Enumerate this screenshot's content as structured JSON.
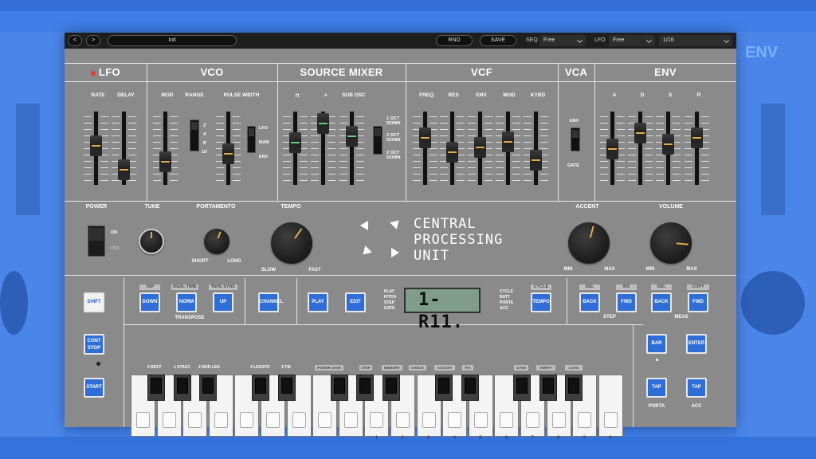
{
  "window": {
    "preset_name": "Init",
    "back_label": "<",
    "forward_label": ">",
    "rnd_label": "RND",
    "save_label": "SAVE",
    "seq_label": "SEQ",
    "seq_value": "Free",
    "lfo_label": "LFO",
    "lfo_value": "Free",
    "rate_value": "1/16"
  },
  "sections": {
    "lfo": "LFO",
    "vco": "VCO",
    "source_mixer": "SOURCE MIXER",
    "vcf": "VCF",
    "vca": "VCA",
    "env": "ENV"
  },
  "lfo": {
    "rate": "RATE",
    "delay": "DELAY"
  },
  "vco": {
    "mod": "MOD",
    "range": "RANGE",
    "pulse_width": "PULSE WIDTH",
    "range_marks": [
      "2'",
      "4'",
      "8'",
      "16'"
    ],
    "pw_modes": [
      "LFO",
      "MAN",
      "ENV"
    ]
  },
  "mixer": {
    "saw": "⩘",
    "square": "⊓",
    "sub_osc": "SUB OSC",
    "sub_modes": [
      "1 OCT DOWN",
      "2 OCT DOWN",
      "2 OCT DOWN"
    ]
  },
  "vcf": {
    "freq": "FREQ",
    "res": "RES",
    "env": "ENV",
    "mod": "MOD",
    "kybd": "KYBD"
  },
  "vca": {
    "env": "ENV",
    "gate": "GATE"
  },
  "env": {
    "a": "A",
    "d": "D",
    "s": "S",
    "r": "R"
  },
  "controls": {
    "power": "POWER",
    "on": "ON",
    "off": "OFF",
    "tune": "TUNE",
    "portamento": "PORTAMENTO",
    "short": "SHORT",
    "long": "LONG",
    "tempo": "TEMPO",
    "slow": "SLOW",
    "fast": "FAST",
    "accent": "ACCENT",
    "volume": "VOLUME",
    "min": "MIN",
    "max": "MAX"
  },
  "logo": {
    "line1": "CENTRAL",
    "line2": "PROCESSING",
    "line3": "UNIT"
  },
  "buttons": {
    "shift": "SHIFT",
    "tap": "TAP",
    "real_time": "REAL TIME",
    "tape_sync": "TAPE SYNC",
    "down": "DOWN",
    "norm": "NORM",
    "up": "UP",
    "transpose": "TRANSPOSE",
    "channel": "CHANNEL",
    "play": "PLAY",
    "edit": "EDIT",
    "cycle": "CYCLE",
    "tempo": "TEMPO",
    "del": "DEL",
    "ins": "INS",
    "del2": "DEL",
    "copy": "COPY",
    "back": "BACK",
    "fwd": "FWD",
    "step": "STEP",
    "meas": "MEAS",
    "cont_stop": "CONT STOP",
    "start": "START",
    "bar": "BAR",
    "enter": "ENTER",
    "tap_porta": "TAP",
    "tap_acc": "TAP",
    "porta": "PORTA",
    "acc": "ACC"
  },
  "lcd": {
    "text": "1-R11.",
    "left_labels": [
      "PLAY",
      "PITCH",
      "STEP",
      "GATE"
    ],
    "right_labels": [
      "CYCLE",
      "BATT",
      "PORTA",
      "ACC"
    ]
  },
  "keyboard": {
    "note_labels": [
      "0 REST",
      "1 STACC",
      "2 NON LEG",
      "3 LEGATO",
      "4 TIE"
    ],
    "tags": [
      "POWER SAVE",
      "STEP",
      "MEMORY",
      "CHECK",
      "ACCENT",
      "F/A",
      "SAVE",
      "VERIFY",
      "LOAD"
    ],
    "numbers": [
      "1",
      "2",
      "3",
      "4",
      "5",
      "6",
      "7",
      "8",
      "9",
      "0"
    ]
  }
}
